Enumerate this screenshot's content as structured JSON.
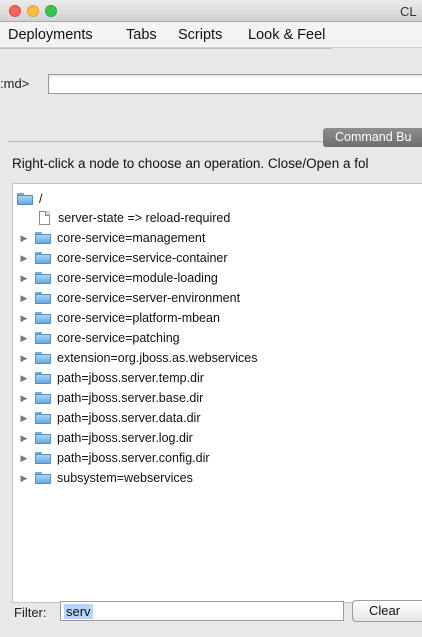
{
  "window": {
    "title": "CL"
  },
  "menu": {
    "items": [
      {
        "label": "Deployments"
      },
      {
        "label": "Tabs"
      },
      {
        "label": "Scripts"
      },
      {
        "label": "Look & Feel"
      }
    ]
  },
  "cmd": {
    "label": ":md>",
    "value": ""
  },
  "panel": {
    "tab_label": "Command Bu"
  },
  "instructions": "Right-click a node to choose an operation.  Close/Open a fol",
  "tree": {
    "root_label": "/",
    "nodes": [
      {
        "label": "server-state => reload-required",
        "kind": "leaf"
      },
      {
        "label": "core-service=management",
        "kind": "folder"
      },
      {
        "label": "core-service=service-container",
        "kind": "folder"
      },
      {
        "label": "core-service=module-loading",
        "kind": "folder"
      },
      {
        "label": "core-service=server-environment",
        "kind": "folder"
      },
      {
        "label": "core-service=platform-mbean",
        "kind": "folder"
      },
      {
        "label": "core-service=patching",
        "kind": "folder"
      },
      {
        "label": "extension=org.jboss.as.webservices",
        "kind": "folder"
      },
      {
        "label": "path=jboss.server.temp.dir",
        "kind": "folder"
      },
      {
        "label": "path=jboss.server.base.dir",
        "kind": "folder"
      },
      {
        "label": "path=jboss.server.data.dir",
        "kind": "folder"
      },
      {
        "label": "path=jboss.server.log.dir",
        "kind": "folder"
      },
      {
        "label": "path=jboss.server.config.dir",
        "kind": "folder"
      },
      {
        "label": "subsystem=webservices",
        "kind": "folder"
      }
    ]
  },
  "filter": {
    "label": "Filter:",
    "value": "serv"
  },
  "clear_button": {
    "label": "Clear"
  }
}
